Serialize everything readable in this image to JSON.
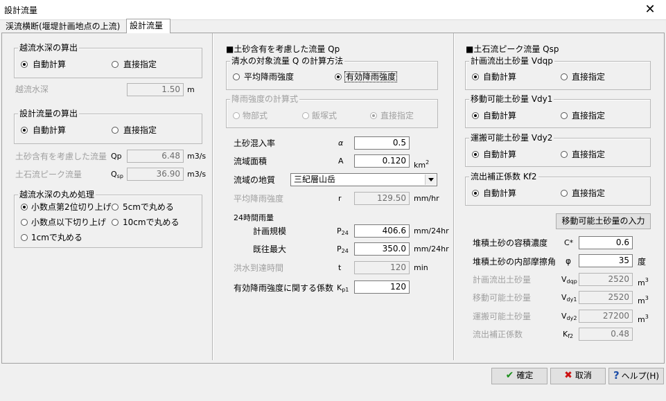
{
  "window": {
    "title": "設計流量",
    "close_glyph": "✕"
  },
  "tabs": [
    {
      "label": "渓流横断(堰堤計画地点の上流)"
    },
    {
      "label": "設計流量"
    }
  ],
  "left": {
    "overflow_group": {
      "title": "越流水深の算出",
      "opt_auto": "自動計算",
      "opt_direct": "直接指定"
    },
    "overflow_depth": {
      "label": "越流水深",
      "value": "1.50",
      "unit": "m"
    },
    "design_group": {
      "title": "設計流量の算出",
      "opt_auto": "自動計算",
      "opt_direct": "直接指定"
    },
    "qp": {
      "label": "土砂含有を考慮した流量",
      "sym": "Qp",
      "value": "6.48",
      "unit": "m3/s"
    },
    "qsp": {
      "label": "土石流ピーク流量",
      "sym_main": "Q",
      "sym_sub": "sp",
      "value": "36.90",
      "unit": "m3/s"
    },
    "round_group": {
      "title": "越流水深の丸め処理",
      "opt1": "小数点第2位切り上げ",
      "opt2": "5cmで丸める",
      "opt3": "小数点以下切り上げ",
      "opt4": "10cmで丸める",
      "opt5": "1cmで丸める"
    }
  },
  "middle": {
    "heading": "■土砂含有を考慮した流量 Qp",
    "clear_group": {
      "title": "清水の対象流量 Q の計算方法",
      "opt_avg": "平均降雨強度",
      "opt_eff": "有効降雨強度"
    },
    "rain_group": {
      "title": "降雨強度の計算式",
      "opt1": "物部式",
      "opt2": "飯塚式",
      "opt3": "直接指定"
    },
    "alpha": {
      "label": "土砂混入率",
      "sym": "α",
      "value": "0.5"
    },
    "area": {
      "label": "流域面積",
      "sym": "A",
      "value": "0.120",
      "unit_main": "km",
      "unit_sup": "2"
    },
    "geology": {
      "label": "流域の地質",
      "selected": "三紀層山岳"
    },
    "avg_rain": {
      "label": "平均降雨強度",
      "sym": "r",
      "value": "129.50",
      "unit": "mm/hr"
    },
    "rain24": {
      "label": "24時間雨量"
    },
    "plan": {
      "label": "計画規模",
      "sym_main": "P",
      "sym_sub": "24",
      "value": "406.6",
      "unit": "mm/24hr"
    },
    "max": {
      "label": "既往最大",
      "sym_main": "P",
      "sym_sub": "24",
      "value": "350.0",
      "unit": "mm/24hr"
    },
    "flood_time": {
      "label": "洪水到達時間",
      "sym": "t",
      "value": "120",
      "unit": "min"
    },
    "kp1": {
      "label": "有効降雨強度に関する係数",
      "sym_main": "K",
      "sym_sub": "p1",
      "value": "120"
    }
  },
  "right": {
    "heading": "■土石流ピーク流量 Qsp",
    "vdqp_group": {
      "title": "計画流出土砂量 Vdqp",
      "opt_auto": "自動計算",
      "opt_direct": "直接指定"
    },
    "vdy1_group": {
      "title": "移動可能土砂量 Vdy1",
      "opt_auto": "自動計算",
      "opt_direct": "直接指定"
    },
    "vdy2_group": {
      "title": "運搬可能土砂量 Vdy2",
      "opt_auto": "自動計算",
      "opt_direct": "直接指定"
    },
    "kf2_group": {
      "title": "流出補正係数 Kf2",
      "opt_auto": "自動計算",
      "opt_direct": "直接指定"
    },
    "input_button": "移動可能土砂量の入力",
    "cstar": {
      "label": "堆積土砂の容積濃度",
      "sym": "C*",
      "value": "0.6"
    },
    "phi": {
      "label": "堆積土砂の内部摩擦角",
      "sym": "φ",
      "value": "35",
      "unit": "度"
    },
    "vdqp": {
      "label": "計画流出土砂量",
      "sym_main": "V",
      "sym_sub": "dqp",
      "value": "2520",
      "unit_main": "m",
      "unit_sup": "3"
    },
    "vdy1": {
      "label": "移動可能土砂量",
      "sym_main": "V",
      "sym_sub": "dy1",
      "value": "2520",
      "unit_main": "m",
      "unit_sup": "3"
    },
    "vdy2": {
      "label": "運搬可能土砂量",
      "sym_main": "V",
      "sym_sub": "dy2",
      "value": "27200",
      "unit_main": "m",
      "unit_sup": "3"
    },
    "kf2": {
      "label": "流出補正係数",
      "sym_main": "K",
      "sym_sub": "f2",
      "value": "0.48"
    }
  },
  "footer": {
    "ok": "確定",
    "cancel": "取消",
    "help": "ヘルプ(H)"
  },
  "colors": {
    "ok_check": "#1a8f1a",
    "cancel_x": "#cc1111",
    "help_q": "#1f4fa8"
  }
}
